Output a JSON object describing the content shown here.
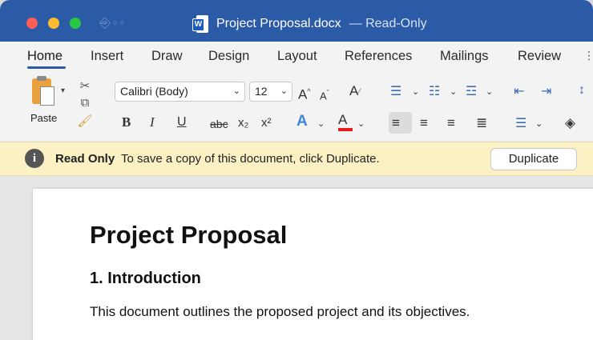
{
  "window": {
    "title": "Project Proposal.docx",
    "mode_suffix": "— Read-Only",
    "app_badge": "W"
  },
  "tabs": [
    {
      "label": "Home",
      "active": true
    },
    {
      "label": "Insert"
    },
    {
      "label": "Draw"
    },
    {
      "label": "Design"
    },
    {
      "label": "Layout"
    },
    {
      "label": "References"
    },
    {
      "label": "Mailings"
    },
    {
      "label": "Review"
    }
  ],
  "ribbon": {
    "paste_label": "Paste",
    "font_name": "Calibri (Body)",
    "font_size": "12",
    "bold": "B",
    "italic": "I",
    "underline": "U",
    "strikethrough": "abc",
    "subscript": "x₂",
    "superscript": "x²",
    "text_effects": "A",
    "font_color": "A",
    "font_color_value": "#e81a1a",
    "grow_font": "A^",
    "shrink_font": "Aˇ",
    "clear_formatting": "A⁄"
  },
  "readonly_bar": {
    "title": "Read Only",
    "message": "To save a copy of this document, click Duplicate.",
    "button": "Duplicate",
    "background": "#fbf1c4"
  },
  "document": {
    "heading": "Project Proposal",
    "subheading": "1. Introduction",
    "paragraph": "This document outlines the proposed project and its objectives."
  },
  "colors": {
    "titlebar": "#2b5aa6",
    "accent": "#2b5aa6"
  }
}
